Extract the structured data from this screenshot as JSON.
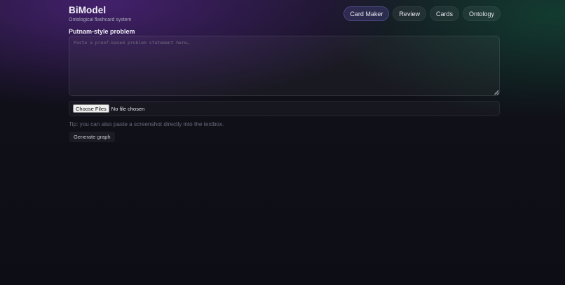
{
  "header": {
    "title": "BiModel",
    "subtitle": "Ontological flashcard system"
  },
  "nav": {
    "items": [
      {
        "label": "Card Maker",
        "active": true
      },
      {
        "label": "Review",
        "active": false
      },
      {
        "label": "Cards",
        "active": false
      },
      {
        "label": "Ontology",
        "active": false
      }
    ]
  },
  "problem": {
    "label": "Putnam-style problem",
    "placeholder": "Paste a proof-based problem statement here…",
    "value": ""
  },
  "file_input": {
    "button_label": "Choose Files",
    "status": "No file chosen"
  },
  "tip": "Tip: you can also paste a screenshot directly into the textbox.",
  "actions": {
    "generate_label": "Generate graph"
  },
  "colors": {
    "accent_active": "#3c386e",
    "background": "#0d0e15",
    "glow_purple": "#4a2278",
    "glow_green": "#124232"
  }
}
